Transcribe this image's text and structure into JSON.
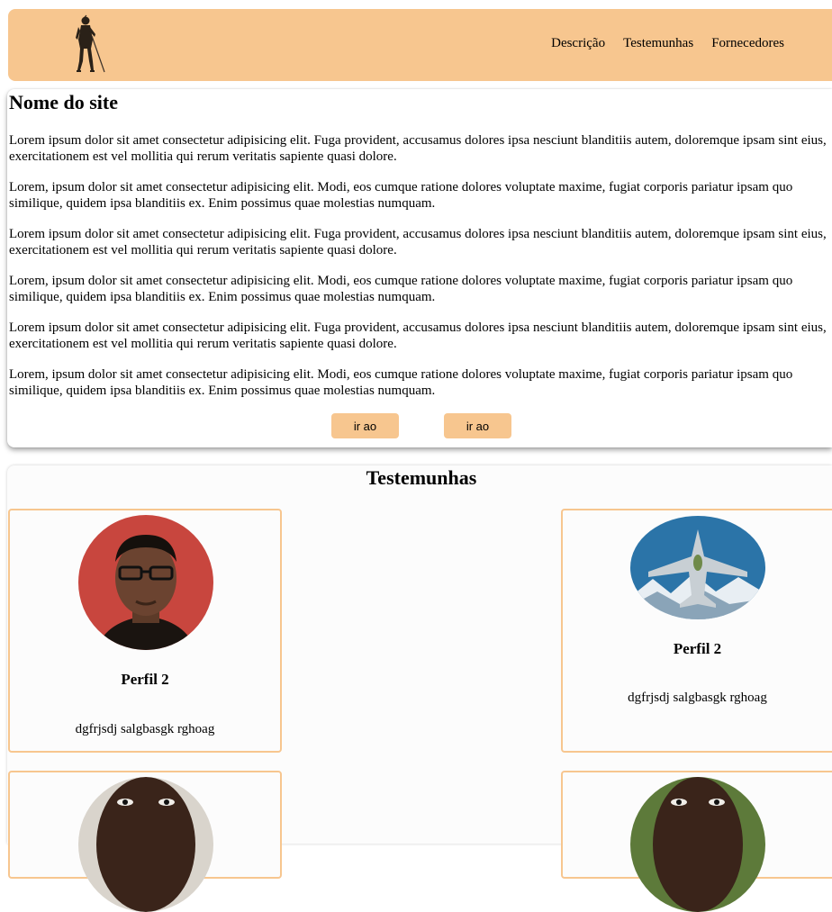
{
  "header": {
    "nav": [
      "Descrição",
      "Testemunhas",
      "Fornecedores"
    ],
    "logo_icon": "warrior-silhouette-icon",
    "background": "#f7c68f"
  },
  "main": {
    "title": "Nome do site",
    "paragraphs": [
      "Lorem ipsum dolor sit amet consectetur adipisicing elit. Fuga provident, accusamus dolores ipsa nesciunt blanditiis autem, doloremque ipsam sint eius, exercitationem est vel mollitia qui rerum veritatis sapiente quasi dolore.",
      "Lorem, ipsum dolor sit amet consectetur adipisicing elit. Modi, eos cumque ratione dolores voluptate maxime, fugiat corporis pariatur ipsam quo similique, quidem ipsa blanditiis ex. Enim possimus quae molestias numquam.",
      "Lorem ipsum dolor sit amet consectetur adipisicing elit. Fuga provident, accusamus dolores ipsa nesciunt blanditiis autem, doloremque ipsam sint eius, exercitationem est vel mollitia qui rerum veritatis sapiente quasi dolore.",
      "Lorem, ipsum dolor sit amet consectetur adipisicing elit. Modi, eos cumque ratione dolores voluptate maxime, fugiat corporis pariatur ipsam quo similique, quidem ipsa blanditiis ex. Enim possimus quae molestias numquam.",
      "Lorem ipsum dolor sit amet consectetur adipisicing elit. Fuga provident, accusamus dolores ipsa nesciunt blanditiis autem, doloremque ipsam sint eius, exercitationem est vel mollitia qui rerum veritatis sapiente quasi dolore.",
      "Lorem, ipsum dolor sit amet consectetur adipisicing elit. Modi, eos cumque ratione dolores voluptate maxime, fugiat corporis pariatur ipsam quo similique, quidem ipsa blanditiis ex. Enim possimus quae molestias numquam."
    ],
    "buttons": [
      "ir ao",
      "ir ao"
    ]
  },
  "testimonials": {
    "title": "Testemunhas",
    "cards": [
      {
        "name": "Perfil 2",
        "desc": "dgfrjsdj salgbasgk rghoag"
      },
      {
        "name": "Perfil 2",
        "desc": "dgfrjsdj salgbasgk rghoag"
      }
    ]
  }
}
